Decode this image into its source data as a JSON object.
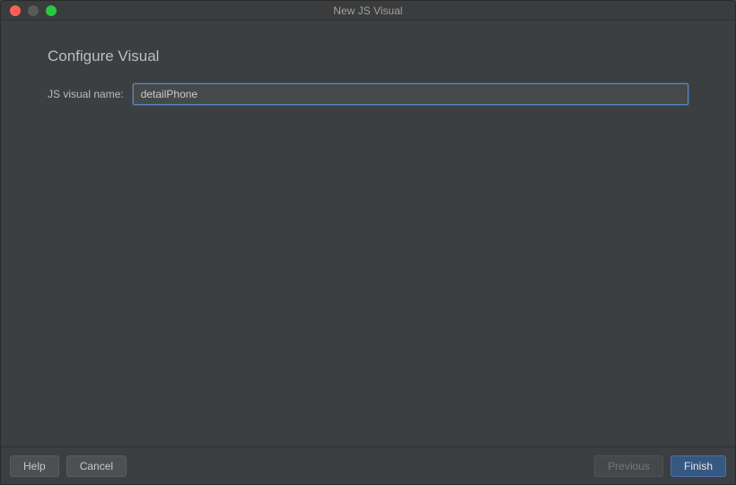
{
  "window": {
    "title": "New JS Visual"
  },
  "page": {
    "heading": "Configure Visual"
  },
  "form": {
    "name_label": "JS visual name:",
    "name_value": "detailPhone"
  },
  "buttons": {
    "help": "Help",
    "cancel": "Cancel",
    "previous": "Previous",
    "finish": "Finish"
  }
}
